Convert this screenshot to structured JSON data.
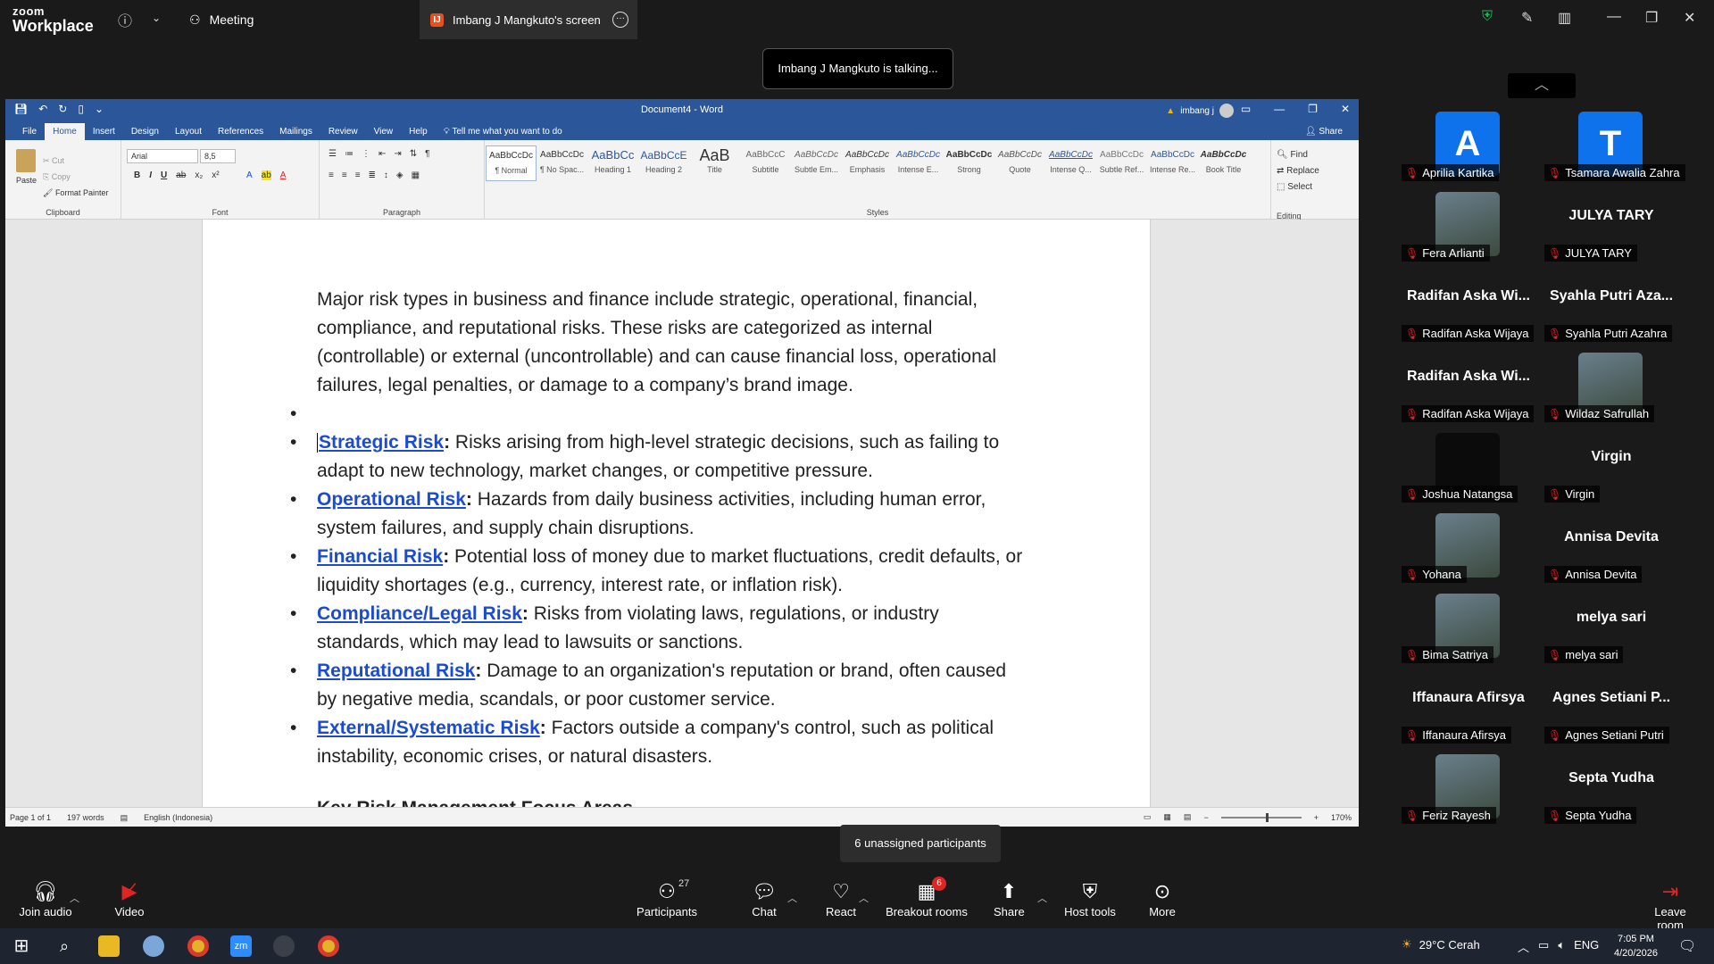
{
  "zoom": {
    "logo_top": "zoom",
    "logo_bottom": "Workplace",
    "meeting_tab": "Meeting",
    "screen_tab": "Imbang J Mangkuto's screen",
    "screen_badge": "IJ",
    "talking": "Imbang J Mangkuto is talking...",
    "unassigned": "6 unassigned participants"
  },
  "word": {
    "title": "Document4 - Word",
    "user": "imbang j",
    "tabs": [
      "File",
      "Home",
      "Insert",
      "Design",
      "Layout",
      "References",
      "Mailings",
      "Review",
      "View",
      "Help"
    ],
    "tell_me": "Tell me what you want to do",
    "share": "Share",
    "clipboard": {
      "paste": "Paste",
      "cut": "Cut",
      "copy": "Copy",
      "format_painter": "Format Painter",
      "label": "Clipboard"
    },
    "font": {
      "name": "Arial",
      "size": "8,5",
      "label": "Font"
    },
    "paragraph_label": "Paragraph",
    "styles_label": "Styles",
    "editing_label": "Editing",
    "styles": [
      {
        "sample": "AaBbCcDc",
        "name": "¶ Normal"
      },
      {
        "sample": "AaBbCcDc",
        "name": "¶ No Spac..."
      },
      {
        "sample": "AaBbCc",
        "name": "Heading 1"
      },
      {
        "sample": "AaBbCcE",
        "name": "Heading 2"
      },
      {
        "sample": "AaB",
        "name": "Title"
      },
      {
        "sample": "AaBbCcC",
        "name": "Subtitle"
      },
      {
        "sample": "AaBbCcDc",
        "name": "Subtle Em..."
      },
      {
        "sample": "AaBbCcDc",
        "name": "Emphasis"
      },
      {
        "sample": "AaBbCcDc",
        "name": "Intense E..."
      },
      {
        "sample": "AaBbCcDc",
        "name": "Strong"
      },
      {
        "sample": "AaBbCcDc",
        "name": "Quote"
      },
      {
        "sample": "AaBbCcDc",
        "name": "Intense Q..."
      },
      {
        "sample": "AaBbCcDc",
        "name": "Subtle Ref..."
      },
      {
        "sample": "AaBbCcDc",
        "name": "Intense Re..."
      },
      {
        "sample": "AaBbCcDc",
        "name": "Book Title"
      }
    ],
    "editing": {
      "find": "Find",
      "replace": "Replace",
      "select": "Select"
    },
    "doc": {
      "intro": "Major risk types in business and finance include strategic, operational, financial, compliance, and reputational risks. These risks are categorized as internal (controllable) or external (uncontrollable) and can cause financial loss, operational failures, legal penalties, or damage to a company’s brand image.",
      "items": [
        {
          "term": "Strategic Risk",
          "desc": " Risks arising from high-level strategic decisions, such as failing to adapt to new technology, market changes, or competitive pressure."
        },
        {
          "term": "Operational Risk",
          "desc": " Hazards from daily business activities, including human error, system failures, and supply chain disruptions."
        },
        {
          "term": "Financial Risk",
          "desc": " Potential loss of money due to market fluctuations, credit defaults, or liquidity shortages (e.g., currency, interest rate, or inflation risk)."
        },
        {
          "term": "Compliance/Legal Risk",
          "desc": " Risks from violating laws, regulations, or industry standards, which may lead to lawsuits or sanctions."
        },
        {
          "term": "Reputational Risk",
          "desc": " Damage to an organization's reputation or brand, often caused by negative media, scandals, or poor customer service."
        },
        {
          "term": "External/Systematic Risk",
          "desc": " Factors outside a company's control, such as political instability, economic crises, or natural disasters."
        }
      ],
      "heading": "Key Risk Management Focus Areas"
    },
    "status": {
      "page": "Page 1 of 1",
      "words": "197 words",
      "lang": "English (Indonesia)",
      "zoom": "170%"
    }
  },
  "participants": [
    {
      "name": "Aprilia Kartika",
      "avatar_letter": "A",
      "avatar_color": "#0e72ed"
    },
    {
      "name": "Tsamara Awalia Zahra",
      "avatar_letter": "T",
      "avatar_color": "#0e72ed"
    },
    {
      "name": "Fera Arlianti",
      "photo": "photo"
    },
    {
      "name": "JULYA TARY",
      "big": "JULYA TARY"
    },
    {
      "name": "Radifan Aska Wijaya",
      "big": "Radifan Aska Wi..."
    },
    {
      "name": "Syahla Putri Azahra",
      "big": "Syahla Putri Aza..."
    },
    {
      "name": "Radifan Aska Wijaya",
      "big": "Radifan Aska Wi..."
    },
    {
      "name": "Wildaz Safrullah",
      "photo": "photo"
    },
    {
      "name": "Joshua Natangsa",
      "photo": "dark"
    },
    {
      "name": "Virgin",
      "big": "Virgin"
    },
    {
      "name": "Yohana",
      "photo": "photo"
    },
    {
      "name": "Annisa Devita",
      "big": "Annisa Devita"
    },
    {
      "name": "Bima Satriya",
      "photo": "photo"
    },
    {
      "name": "melya sari",
      "big": "melya sari"
    },
    {
      "name": "Iffanaura Afirsya",
      "big": "Iffanaura Afirsya"
    },
    {
      "name": "Agnes Setiani Putri",
      "big": "Agnes Setiani P..."
    },
    {
      "name": "Feriz Rayesh",
      "photo": "photo"
    },
    {
      "name": "Septa Yudha",
      "big": "Septa Yudha"
    }
  ],
  "toolbar": {
    "join_audio": "Join audio",
    "video": "Video",
    "participants": "Participants",
    "participants_count": "27",
    "chat": "Chat",
    "react": "React",
    "breakout": "Breakout rooms",
    "breakout_badge": "6",
    "share": "Share",
    "host_tools": "Host tools",
    "more": "More",
    "leave": "Leave room"
  },
  "taskbar": {
    "weather": "29°C Cerah",
    "lang": "ENG",
    "time": "7:05 PM",
    "date": "4/20/2026"
  },
  "colors": {
    "word_blue": "#2b579a",
    "zoom_blue": "#0e72ed",
    "link_blue": "#1b4bd1",
    "mute_red": "#e02424"
  }
}
